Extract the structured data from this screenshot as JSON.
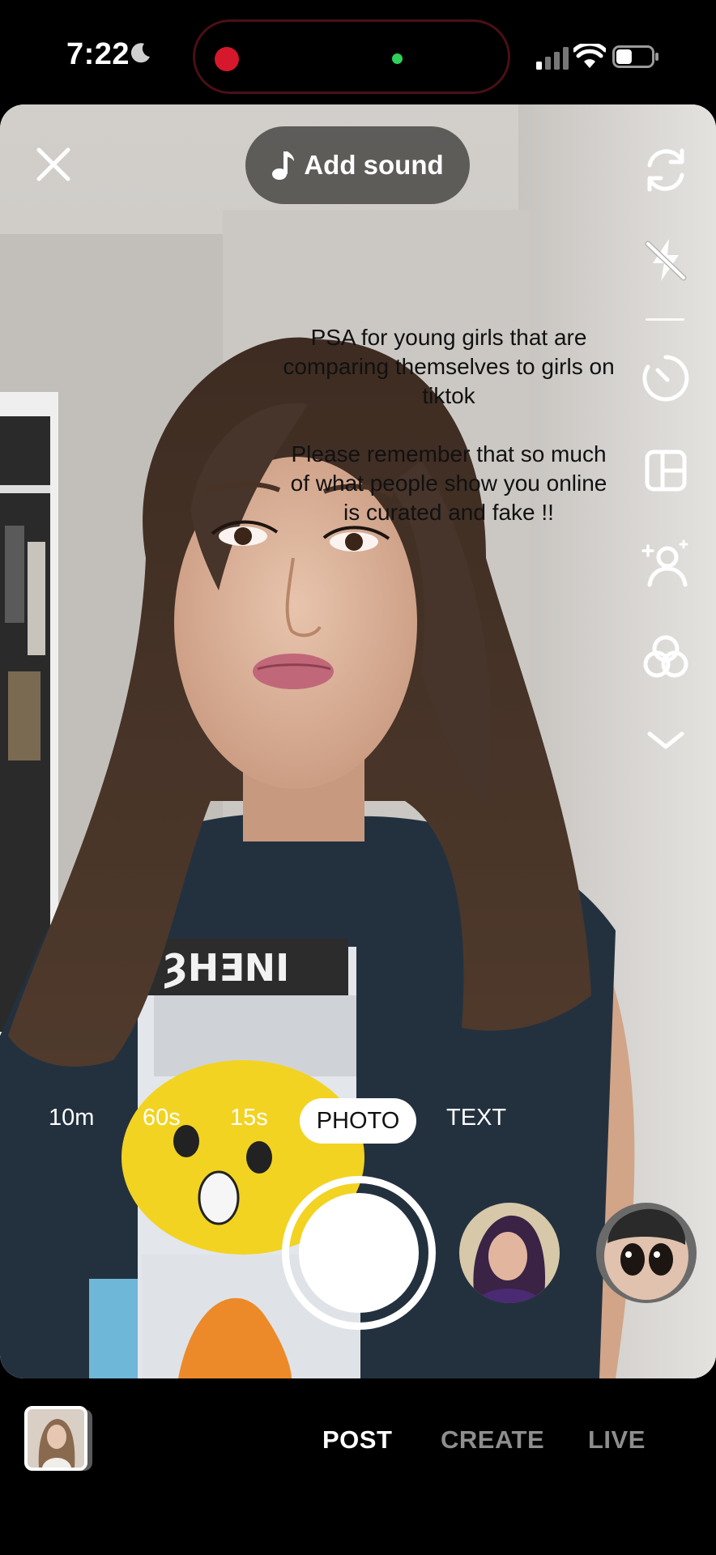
{
  "status_bar": {
    "time": "7:22",
    "focus_icon": "moon-icon",
    "recording_indicator_color": "#d5182b",
    "camera_in_use_color": "#2fd158",
    "battery_level": 0.45
  },
  "camera": {
    "close_icon": "close-icon",
    "add_sound": {
      "icon": "music-note-icon",
      "label": "Add sound"
    },
    "side_tools": [
      {
        "name": "flip-camera-icon"
      },
      {
        "name": "flash-off-icon"
      },
      {
        "name": "timer-icon"
      },
      {
        "name": "layout-icon"
      },
      {
        "name": "retouch-icon"
      },
      {
        "name": "filters-icon"
      },
      {
        "name": "chevron-down-icon"
      }
    ],
    "overlay_text": {
      "paragraph1": "PSA for young girls that are comparing themselves to girls on tiktok",
      "paragraph2": "Please remember that so much of what people show you online is curated and fake !!"
    },
    "modes": [
      {
        "label": "10m"
      },
      {
        "label": "60s"
      },
      {
        "label": "15s"
      },
      {
        "label": "PHOTO",
        "selected": true
      },
      {
        "label": "TEXT"
      }
    ]
  },
  "bottom_bar": {
    "tabs": [
      {
        "label": "POST",
        "selected": true
      },
      {
        "label": "CREATE"
      },
      {
        "label": "LIVE"
      }
    ]
  }
}
